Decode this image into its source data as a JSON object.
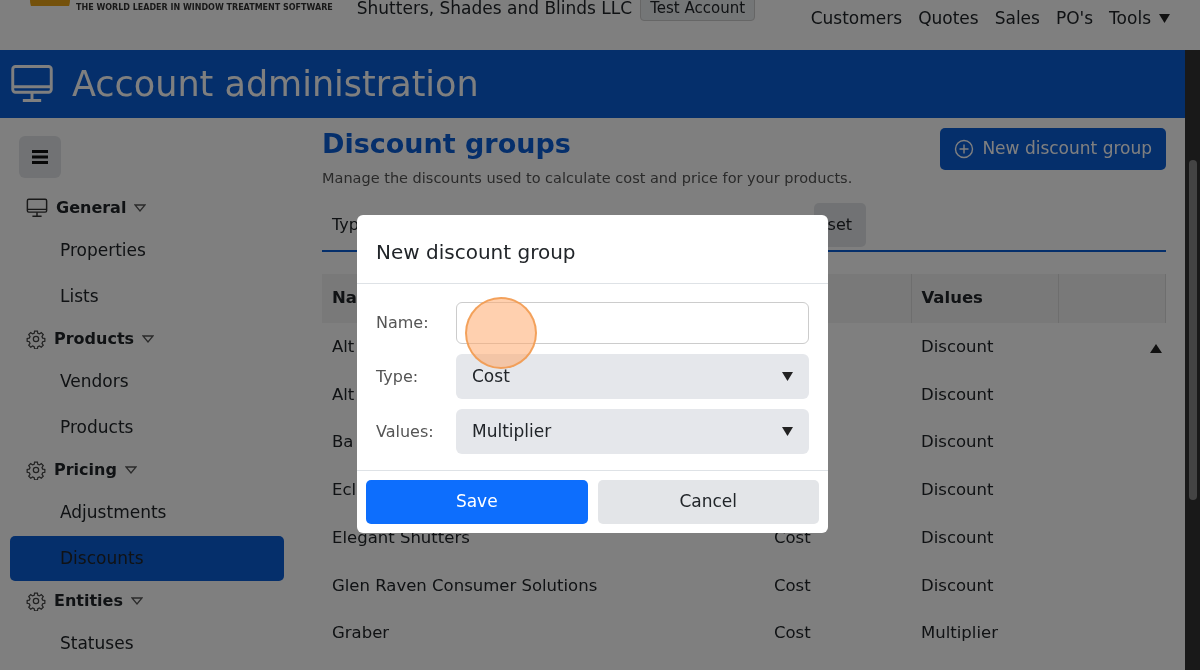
{
  "header": {
    "tagline": "THE WORLD LEADER IN WINDOW TREATMENT SOFTWARE",
    "company": "Shutters, Shades and Blinds LLC",
    "account_badge": "Test Account",
    "nav": [
      {
        "label": "Customers",
        "dropdown": false
      },
      {
        "label": "Quotes",
        "dropdown": false
      },
      {
        "label": "Sales",
        "dropdown": false
      },
      {
        "label": "PO's",
        "dropdown": false
      },
      {
        "label": "Tools",
        "dropdown": true
      }
    ]
  },
  "page_title": "Account administration",
  "sidebar": {
    "items": [
      {
        "label": "General",
        "expanded": true,
        "children": [
          {
            "label": "Properties",
            "selected": false
          },
          {
            "label": "Lists",
            "selected": false
          }
        ]
      },
      {
        "label": "Products",
        "expanded": true,
        "children": [
          {
            "label": "Vendors",
            "selected": false
          },
          {
            "label": "Products",
            "selected": false
          }
        ]
      },
      {
        "label": "Pricing",
        "expanded": true,
        "children": [
          {
            "label": "Adjustments",
            "selected": false
          },
          {
            "label": "Discounts",
            "selected": true
          }
        ]
      },
      {
        "label": "Entities",
        "expanded": true,
        "children": [
          {
            "label": "Statuses",
            "selected": false
          }
        ]
      }
    ]
  },
  "content": {
    "title": "Discount groups",
    "subtitle": "Manage the discounts used to calculate cost and price for your products.",
    "new_button": "New discount group",
    "filter": {
      "label": "Typ",
      "reset": "set"
    },
    "table": {
      "columns": [
        "Na",
        "Values"
      ],
      "rows": [
        {
          "name": "Alt",
          "values": "Discount"
        },
        {
          "name": "Alt",
          "values": "Discount"
        },
        {
          "name": "Ba",
          "values": "Discount"
        },
        {
          "name": "Ecl",
          "values": "Discount"
        },
        {
          "name": "Elegant Shutters",
          "type": "Cost",
          "values": "Discount"
        },
        {
          "name": "Glen Raven Consumer Solutions",
          "type": "Cost",
          "values": "Discount"
        },
        {
          "name": "Graber",
          "type": "Cost",
          "values": "Multiplier"
        }
      ]
    }
  },
  "modal": {
    "title": "New discount group",
    "fields": [
      {
        "label": "Name:",
        "kind": "text"
      },
      {
        "label": "Type:",
        "kind": "select",
        "value": "Cost"
      },
      {
        "label": "Values:",
        "kind": "select",
        "value": "Multiplier"
      }
    ],
    "buttons": [
      {
        "label": "Save",
        "kind": "primary"
      },
      {
        "label": "Cancel",
        "kind": "secondary"
      }
    ]
  }
}
